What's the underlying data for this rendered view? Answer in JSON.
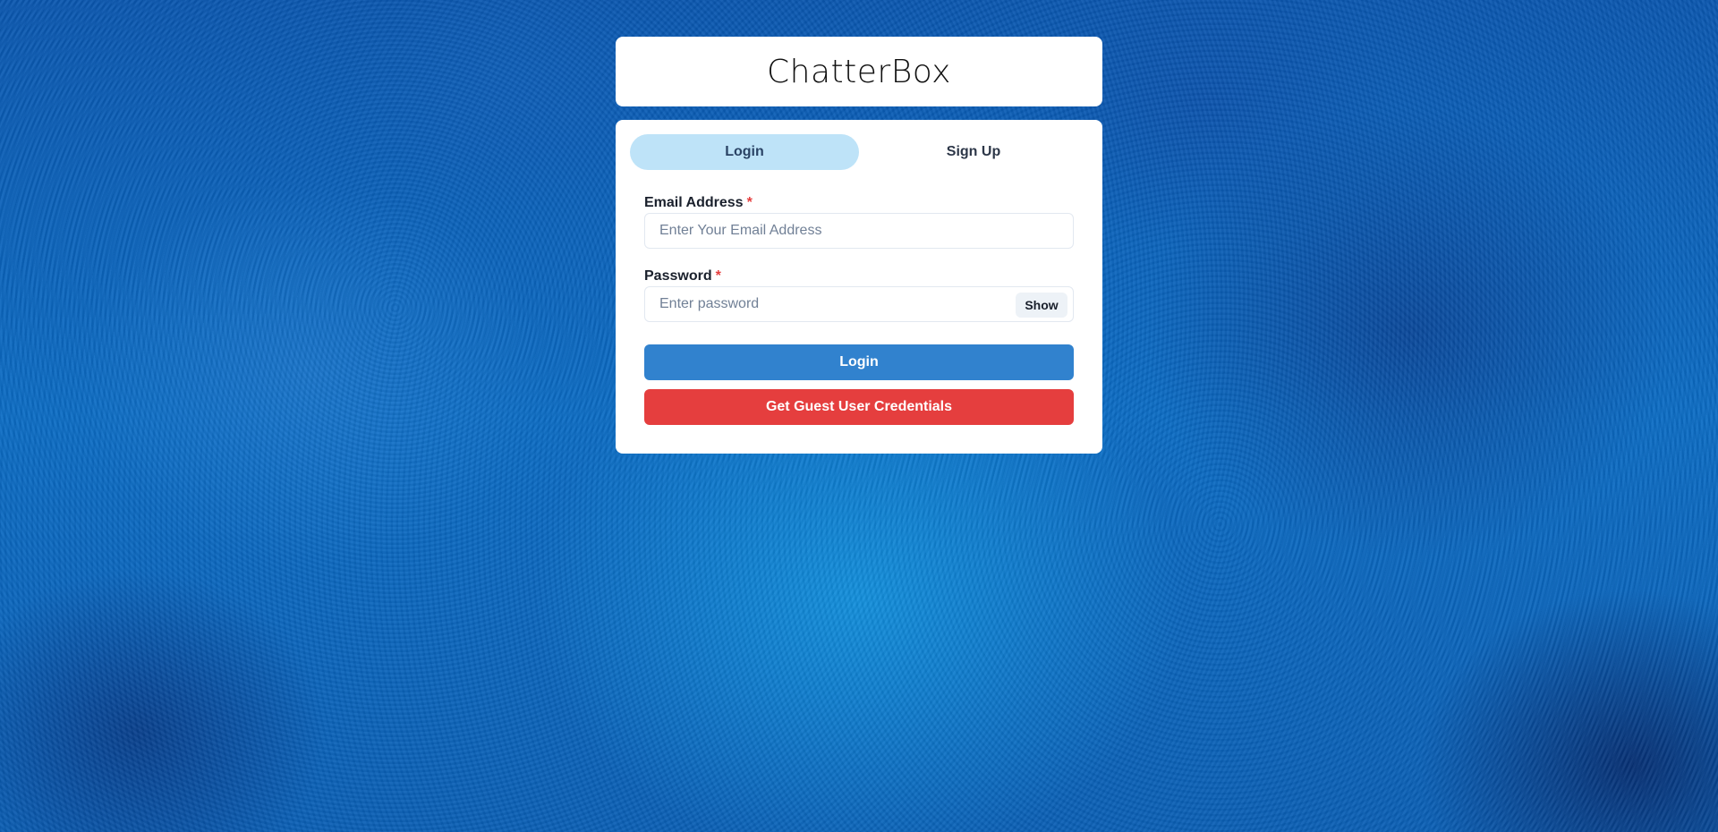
{
  "app": {
    "title": "ChatterBox"
  },
  "tabs": [
    {
      "label": "Login",
      "active": true
    },
    {
      "label": "Sign Up",
      "active": false
    }
  ],
  "form": {
    "email": {
      "label": "Email Address",
      "required_mark": "*",
      "placeholder": "Enter Your Email Address",
      "value": ""
    },
    "password": {
      "label": "Password",
      "required_mark": "*",
      "placeholder": "Enter password",
      "value": "",
      "toggle_label": "Show"
    },
    "login_button": "Login",
    "guest_button": "Get Guest User Credentials"
  },
  "colors": {
    "active_tab_bg": "#bee3f8",
    "login_button_bg": "#3182ce",
    "guest_button_bg": "#e53e3e",
    "required_mark": "#e53e3e"
  }
}
